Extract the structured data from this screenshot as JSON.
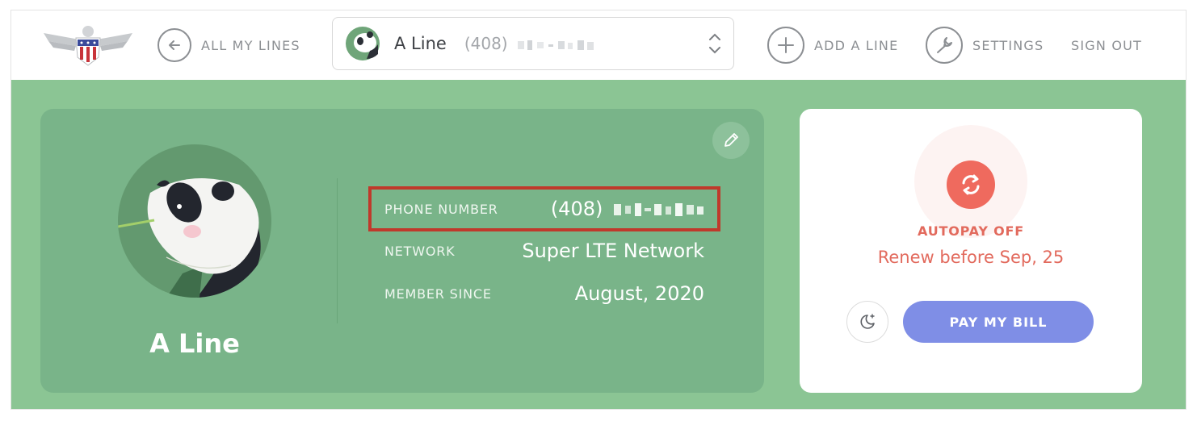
{
  "header": {
    "all_lines_label": "ALL MY LINES",
    "add_line_label": "ADD A LINE",
    "settings_label": "SETTINGS",
    "sign_out_label": "SIGN OUT",
    "line_selector": {
      "name": "A Line",
      "number_prefix": "(408)"
    }
  },
  "line_card": {
    "name": "A Line",
    "details": [
      {
        "label": "PHONE NUMBER",
        "value": "(408)"
      },
      {
        "label": "NETWORK",
        "value": "Super LTE Network"
      },
      {
        "label": "MEMBER SINCE",
        "value": "August, 2020"
      }
    ]
  },
  "billing": {
    "status": "AUTOPAY OFF",
    "renew_text": "Renew before Sep, 25",
    "pay_label": "PAY MY BILL"
  },
  "icons": {
    "logo": "eagle-logo-icon",
    "back": "arrow-left-icon",
    "avatar": "panda-avatar-icon",
    "selector_chevron": "chevron-up-down-icon",
    "add": "plus-icon",
    "settings": "wrench-icon",
    "edit": "pencil-icon",
    "autopay": "sync-icon",
    "schedule": "moon-icon"
  },
  "colors": {
    "background_green": "#8bc594",
    "card_green": "#79b489",
    "alert_red": "#ef6a5e",
    "pay_button": "#7f8ee6",
    "highlight_border": "#c0392b"
  }
}
